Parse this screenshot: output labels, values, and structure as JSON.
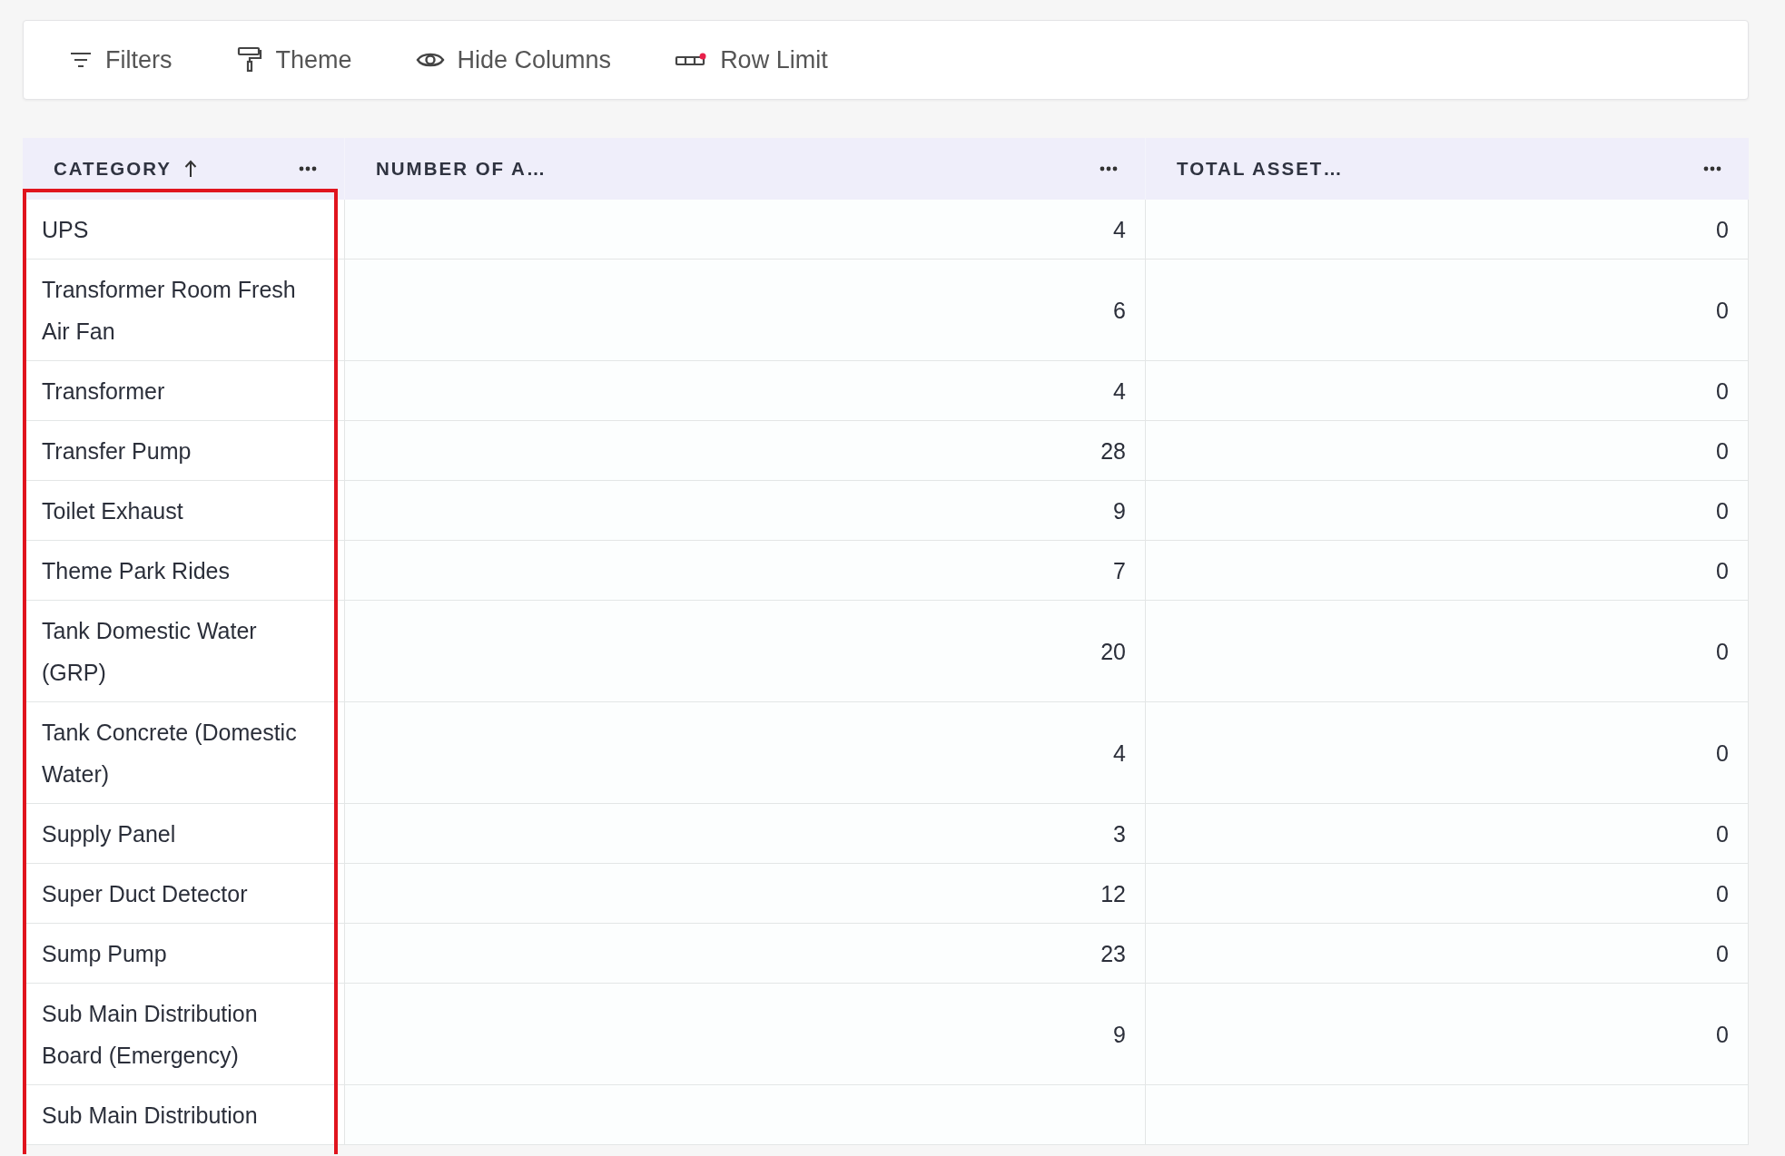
{
  "toolbar": [
    {
      "kind": "filter",
      "label": "Filters"
    },
    {
      "kind": "theme",
      "label": "Theme"
    },
    {
      "kind": "hide",
      "label": "Hide Columns"
    },
    {
      "kind": "limit",
      "label": "Row Limit"
    }
  ],
  "table": {
    "columns": [
      {
        "label": "CATEGORY",
        "sorted": true,
        "highlighted": true
      },
      {
        "label": "NUMBER OF A…",
        "sorted": false,
        "highlighted": false
      },
      {
        "label": "TOTAL ASSET…",
        "sorted": false,
        "highlighted": false
      }
    ],
    "rows": [
      [
        "UPS",
        "4",
        "0"
      ],
      [
        "Transformer Room Fresh Air Fan",
        "6",
        "0"
      ],
      [
        "Transformer",
        "4",
        "0"
      ],
      [
        "Transfer Pump",
        "28",
        "0"
      ],
      [
        "Toilet Exhaust",
        "9",
        "0"
      ],
      [
        "Theme Park Rides",
        "7",
        "0"
      ],
      [
        "Tank Domestic Water (GRP)",
        "20",
        "0"
      ],
      [
        "Tank Concrete (Domestic Water)",
        "4",
        "0"
      ],
      [
        "Supply Panel",
        "3",
        "0"
      ],
      [
        "Super Duct Detector",
        "12",
        "0"
      ],
      [
        "Sump Pump",
        "23",
        "0"
      ],
      [
        "Sub Main Distribution Board (Emergency)",
        "9",
        "0"
      ],
      [
        "Sub Main Distribution"
      ]
    ]
  }
}
